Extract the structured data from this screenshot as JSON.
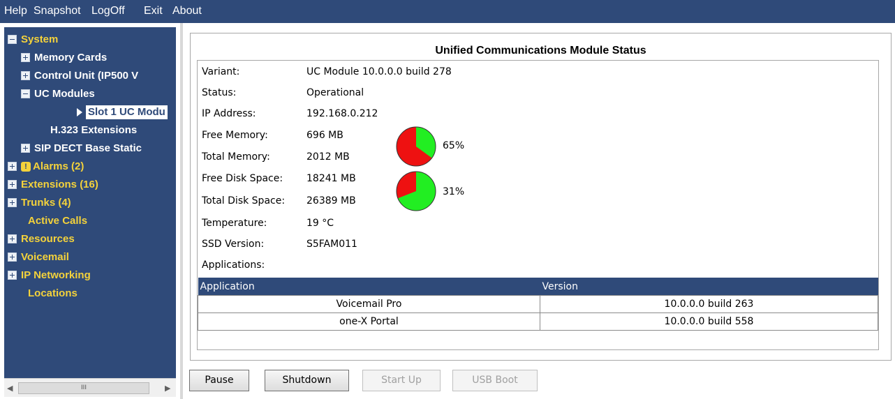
{
  "menu": [
    "Help",
    "Snapshot",
    "LogOff",
    "Exit",
    "About"
  ],
  "tree": {
    "system": "System",
    "memory_cards": "Memory Cards",
    "control_unit": "Control Unit (IP500 V",
    "uc_modules": "UC Modules",
    "slot1": "Slot 1 UC Modu",
    "h323": "H.323 Extensions",
    "sip_dect": "SIP DECT Base Static",
    "alarms": "Alarms (2)",
    "extensions": "Extensions (16)",
    "trunks": "Trunks (4)",
    "active_calls": "Active Calls",
    "resources": "Resources",
    "voicemail": "Voicemail",
    "ip_networking": "IP Networking",
    "locations": "Locations",
    "scroll_grip": "III"
  },
  "panel": {
    "title": "Unified Communications Module Status",
    "fields": [
      {
        "label": "Variant:",
        "value": "UC Module 10.0.0.0 build 278"
      },
      {
        "label": "Status:",
        "value": "Operational"
      },
      {
        "label": "IP Address:",
        "value": "192.168.0.212"
      },
      {
        "label": "Free Memory:",
        "value": "696 MB"
      },
      {
        "label": "Total Memory:",
        "value": "2012 MB"
      },
      {
        "label": "Free Disk Space:",
        "value": "18241 MB"
      },
      {
        "label": "Total Disk Space:",
        "value": "26389 MB"
      },
      {
        "label": "Temperature:",
        "value": "19 °C"
      },
      {
        "label": "SSD Version:",
        "value": "S5FAM011"
      },
      {
        "label": "Applications:",
        "value": ""
      }
    ],
    "memory_pct": "65%",
    "memory_used_fraction": 0.65,
    "disk_pct": "31%",
    "disk_used_fraction": 0.31,
    "colors": {
      "used": "#ee1111",
      "free": "#22ee22"
    }
  },
  "apps": {
    "headers": [
      "Application",
      "Version"
    ],
    "rows": [
      [
        "Voicemail Pro",
        "10.0.0.0 build 263"
      ],
      [
        "one-X Portal",
        "10.0.0.0 build 558"
      ]
    ]
  },
  "buttons": {
    "pause": "Pause",
    "shutdown": "Shutdown",
    "startup": "Start Up",
    "usbboot": "USB Boot"
  }
}
